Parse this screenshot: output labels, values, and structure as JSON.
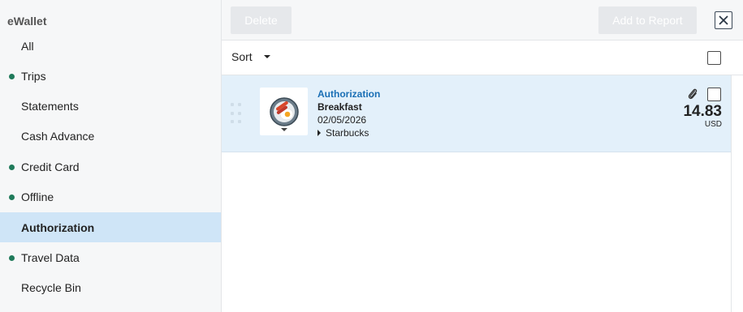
{
  "sidebar": {
    "title": "eWallet",
    "items": [
      {
        "label": "All",
        "dot": false,
        "active": false
      },
      {
        "label": "Trips",
        "dot": true,
        "active": false
      },
      {
        "label": "Statements",
        "dot": false,
        "active": false
      },
      {
        "label": "Cash Advance",
        "dot": false,
        "active": false
      },
      {
        "label": "Credit Card",
        "dot": true,
        "active": false
      },
      {
        "label": "Offline",
        "dot": true,
        "active": false
      },
      {
        "label": "Authorization",
        "dot": false,
        "active": true
      },
      {
        "label": "Travel Data",
        "dot": true,
        "active": false
      },
      {
        "label": "Recycle Bin",
        "dot": false,
        "active": false
      }
    ]
  },
  "toolbar": {
    "delete_label": "Delete",
    "add_to_report_label": "Add to Report",
    "close_icon": "close-icon"
  },
  "sortbar": {
    "sort_label": "Sort"
  },
  "expense": {
    "type": "Authorization",
    "category": "Breakfast",
    "date": "02/05/2026",
    "vendor": "Starbucks",
    "amount": "14.83",
    "currency": "USD",
    "icon": "breakfast-plate-icon"
  },
  "colors": {
    "accent": "#1a6fb5",
    "dot": "#1f7a5a",
    "active_bg": "#cfe5f7",
    "card_bg": "#e3f0fa"
  }
}
